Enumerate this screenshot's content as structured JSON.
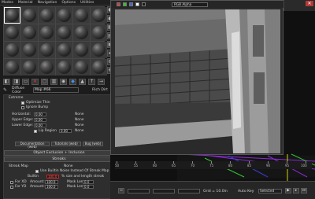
{
  "menu": [
    "Modes",
    "Material",
    "Navigation",
    "Options",
    "Utilities"
  ],
  "editor": {
    "material_label": "Diffuse Color",
    "material_name": "Map #66",
    "material_type": "Rich Dirt"
  },
  "rollout": {
    "section1_title": "Extreme",
    "optimize_thin": "Optimize Thin",
    "ignore_bump": "Ignore Bump",
    "horizontal_label": "Horizontal:",
    "horizontal_value": "0.00",
    "horizontal_option": "None",
    "upper_edge_label": "Upper Edge:",
    "upper_edge_value": "0.00",
    "upper_edge_option": "None",
    "lower_edge_label": "Lower Edge:",
    "lower_edge_value": "0.00",
    "lower_edge_option": "None",
    "lip_region_label": "Lip Region",
    "lip_value": "0.00",
    "lip_option": "None",
    "documentation": "Documentation (web)",
    "tutorials": "Tutorials (web)",
    "bug": "Bug (web)",
    "object_exclusion": "Object Exclusion + Inclusion",
    "streaks_title": "Streaks",
    "streak_map_label": "Streak Map",
    "streak_map_value": "None",
    "use_builtin": "Use Builtin Noise Instead Of Streak Map",
    "builtin_label": "Builtin",
    "builtin_value": "100.0",
    "builtin_suffix": "% size and length streak",
    "for_xd": "For XD",
    "for_yd": "For YD",
    "amount_label": "Amount:",
    "amount_value": "100.0",
    "amount2_value": "100.0",
    "mask_len_label": "Mask Len:",
    "mask_len_value": "0.0",
    "mask_lens_label": "Mask Lens:",
    "mask_lens_value": "0.0"
  },
  "render": {
    "channel": "RGB Alpha"
  },
  "status": {
    "grid": "Grid = 10.0in",
    "auto_key": "Auto Key",
    "selected": "Selected"
  },
  "timeline": [
    "50",
    "55",
    "60",
    "65",
    "70",
    "75",
    "80",
    "85",
    "90",
    "95",
    "100"
  ],
  "colors": {
    "accent_red": "#d83a3a",
    "accent_blue": "#4a8fe0",
    "panel_bg": "#2e2e2e"
  }
}
